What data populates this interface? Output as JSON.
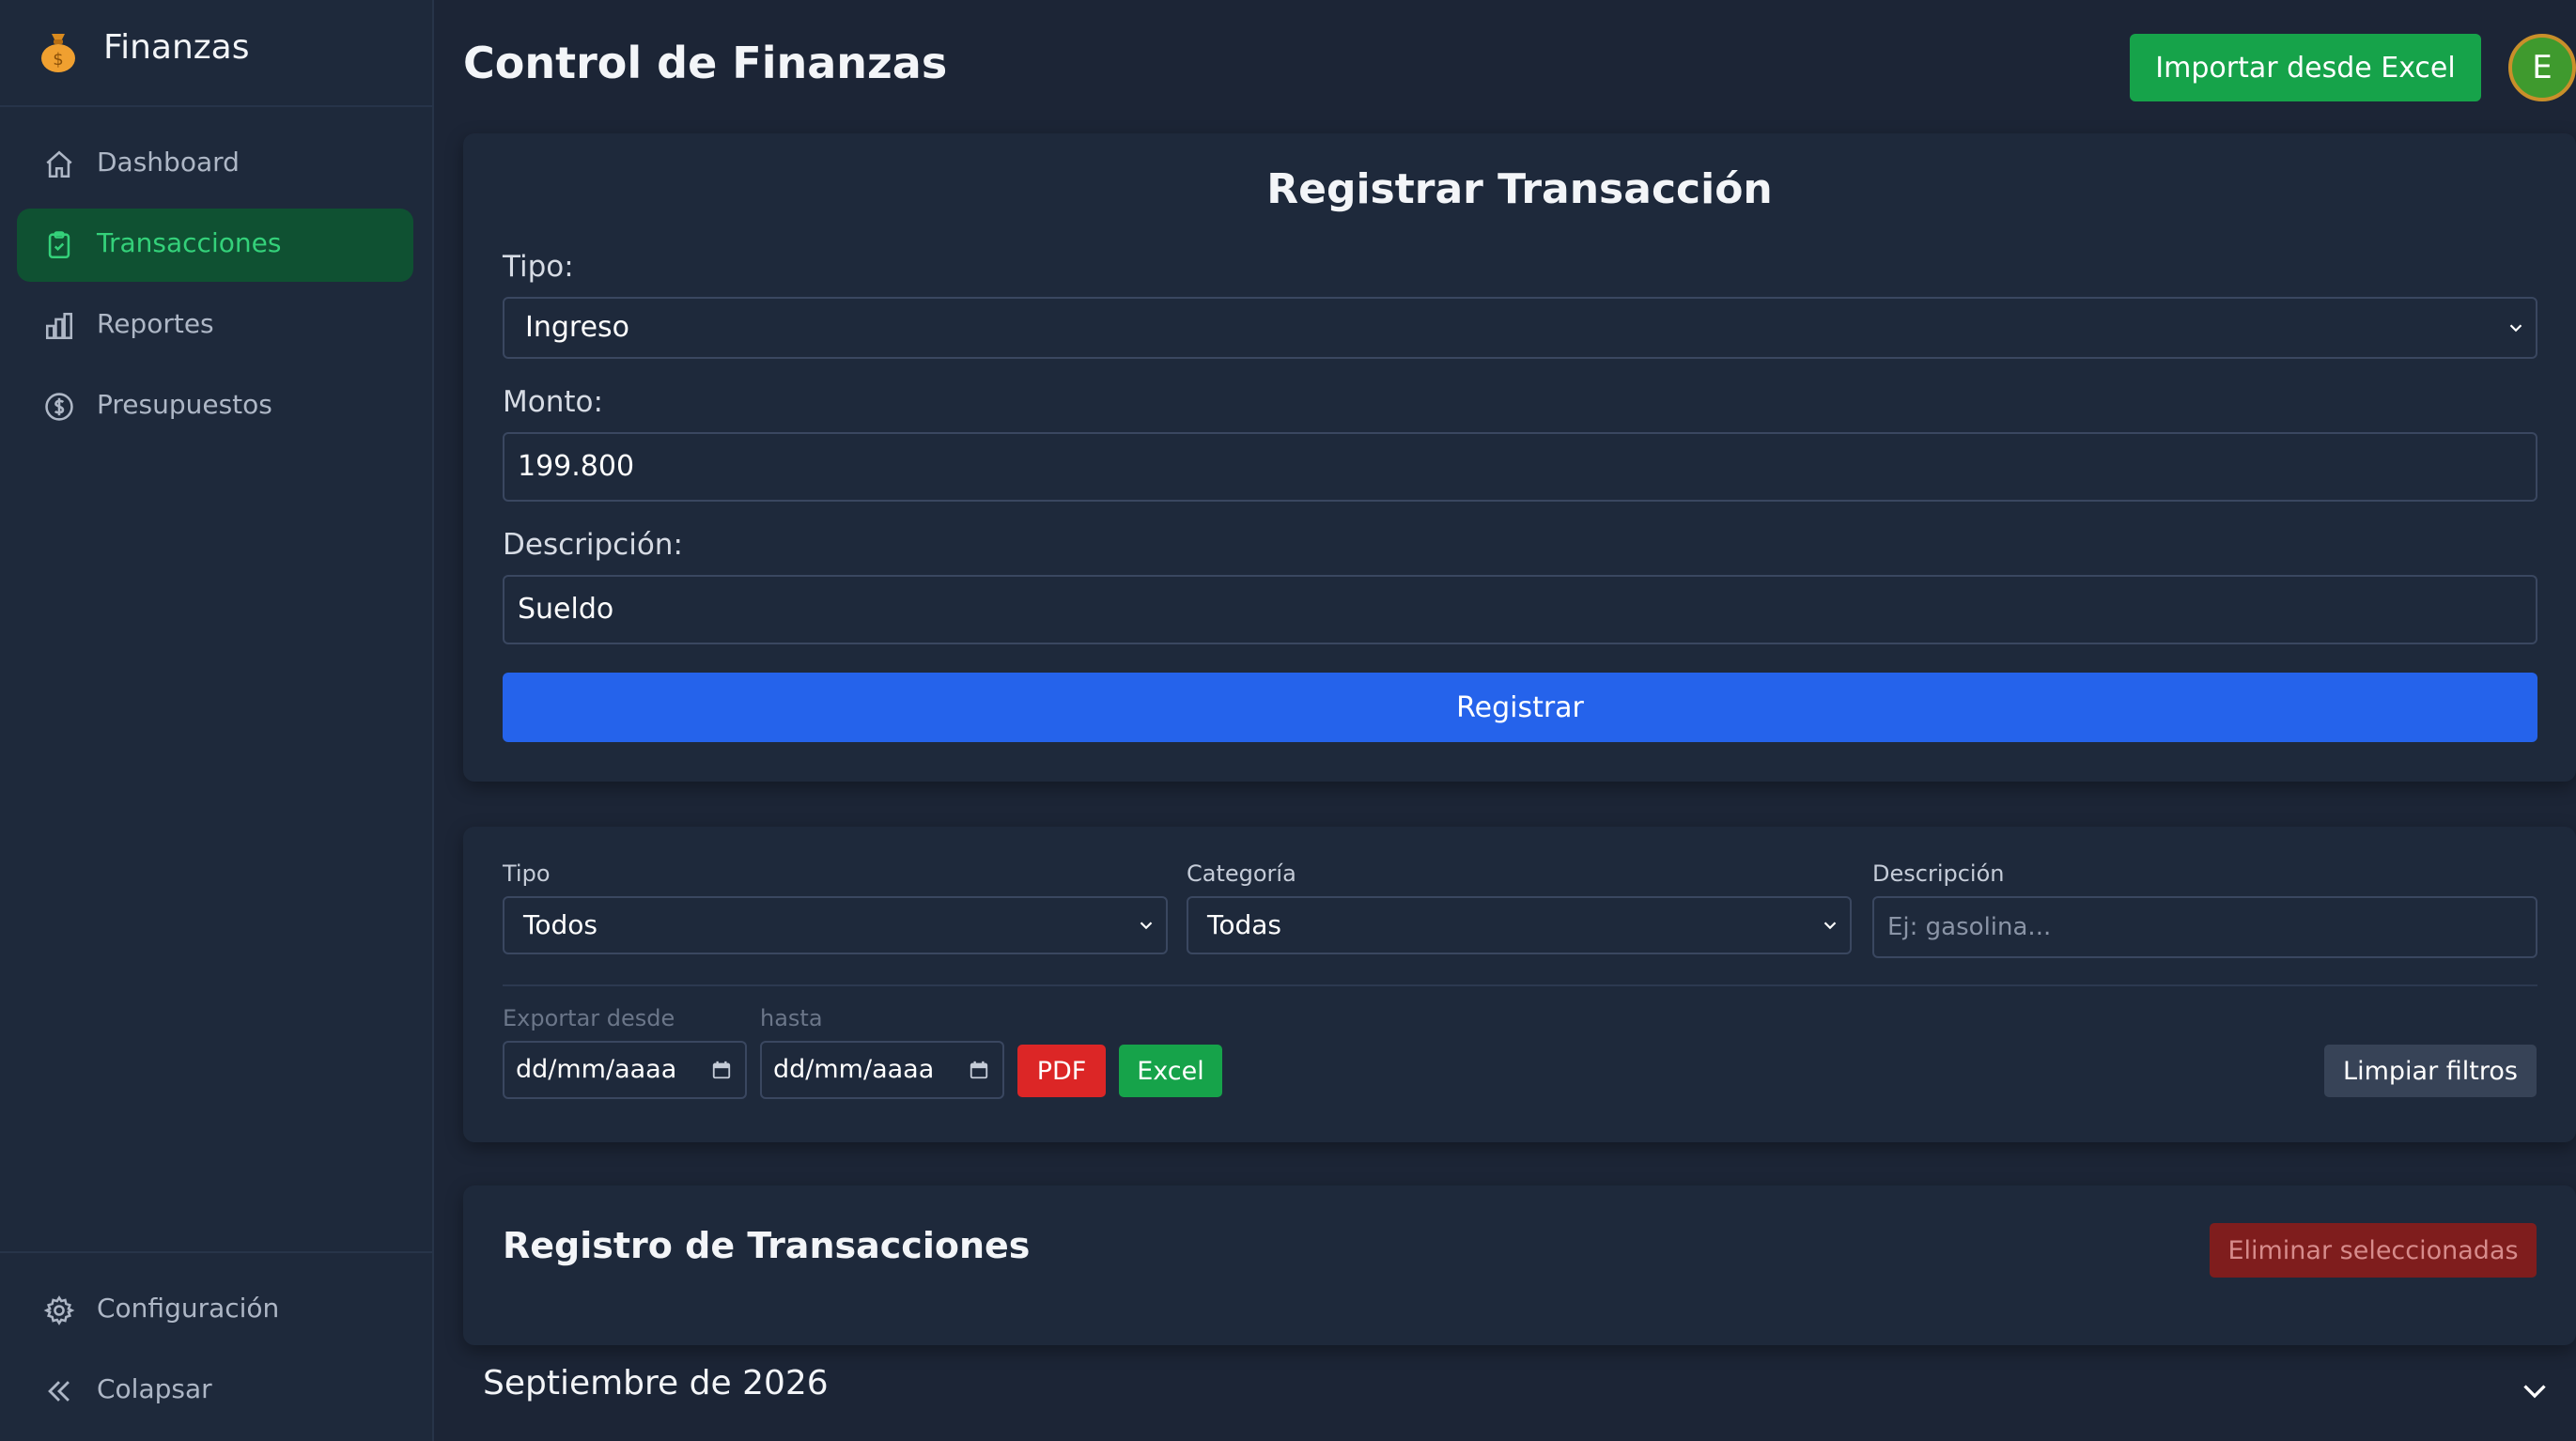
{
  "brand": {
    "name": "Finanzas",
    "icon": "money-bag-icon"
  },
  "sidebar": {
    "items": [
      {
        "label": "Dashboard",
        "icon": "home-icon",
        "active": false
      },
      {
        "label": "Transacciones",
        "icon": "clipboard-icon",
        "active": true
      },
      {
        "label": "Reportes",
        "icon": "bar-chart-icon",
        "active": false
      },
      {
        "label": "Presupuestos",
        "icon": "dollar-circle-icon",
        "active": false
      }
    ],
    "bottom": [
      {
        "label": "Configuración",
        "icon": "gear-icon"
      },
      {
        "label": "Colapsar",
        "icon": "double-chevron-left-icon"
      }
    ]
  },
  "header": {
    "title": "Control de Finanzas",
    "import_label": "Importar desde Excel",
    "avatar_initial": "E"
  },
  "form": {
    "title": "Registrar Transacción",
    "tipo_label": "Tipo:",
    "tipo_value": "Ingreso",
    "monto_label": "Monto:",
    "monto_value": "199.800",
    "descripcion_label": "Descripción:",
    "descripcion_value": "Sueldo",
    "submit_label": "Registrar"
  },
  "filters": {
    "tipo_label": "Tipo",
    "tipo_value": "Todos",
    "categoria_label": "Categoría",
    "categoria_value": "Todas",
    "descripcion_label": "Descripción",
    "descripcion_placeholder": "Ej: gasolina...",
    "export_from_label": "Exportar desde",
    "export_to_label": "hasta",
    "date_placeholder": "dd/mm/aaaa",
    "pdf_label": "PDF",
    "excel_label": "Excel",
    "clear_label": "Limpiar filtros"
  },
  "list": {
    "title": "Registro de Transacciones",
    "delete_label": "Eliminar seleccionadas",
    "month_label": "Septiembre de 2026"
  },
  "colors": {
    "background": "#1c2536",
    "card": "#1e293b",
    "primary_blue": "#2563eb",
    "success_green": "#16a34a",
    "danger_red": "#dc2626",
    "active_nav_bg": "#0f5132",
    "active_nav_text": "#34d17a"
  }
}
